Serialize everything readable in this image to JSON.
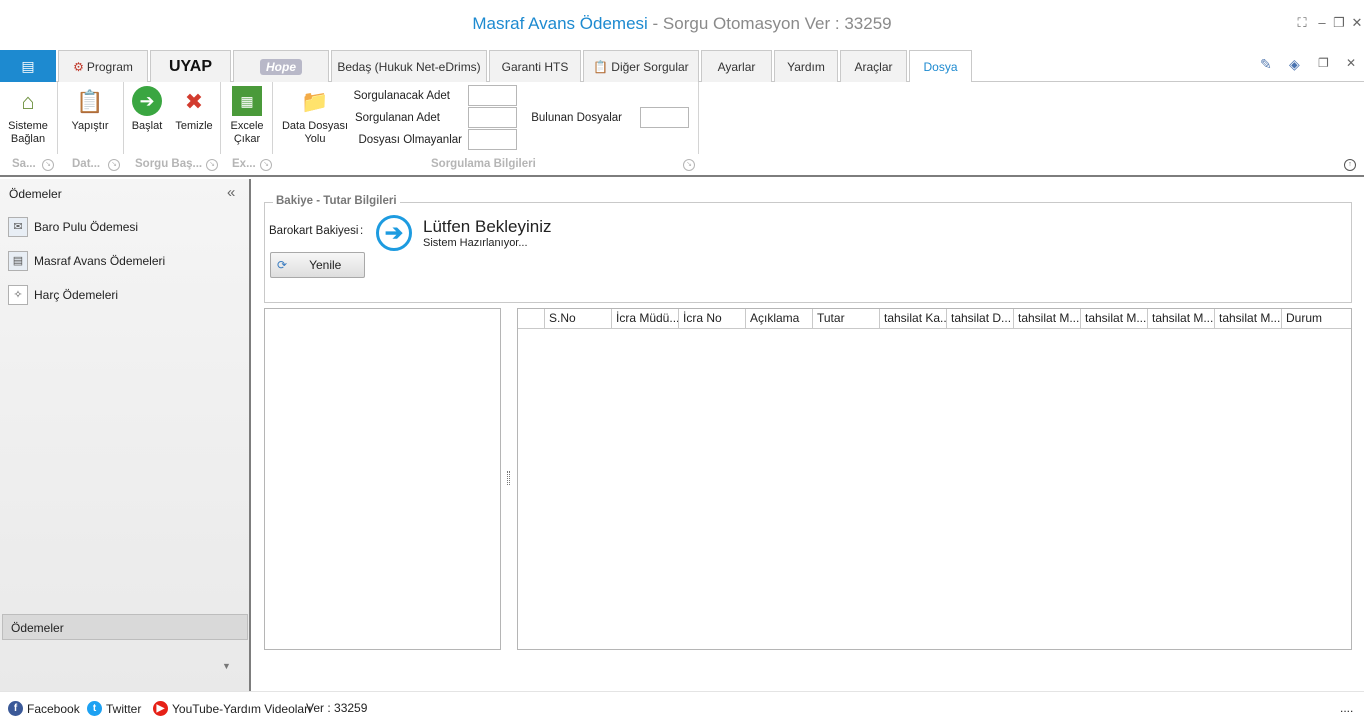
{
  "window": {
    "title_main": "Masraf Avans Ödemesi",
    "title_suffix": " - Sorgu Otomasyon Ver : 33259"
  },
  "tabs": {
    "app_menu": "▤",
    "program": "Program",
    "uyap": "UYAP",
    "hope": "Hope",
    "bedas": "Bedaş (Hukuk Net-eDrims)",
    "garanti": "Garanti HTS",
    "diger": "Diğer Sorgular",
    "ayarlar": "Ayarlar",
    "yardim": "Yardım",
    "araclar": "Araçlar",
    "dosya": "Dosya"
  },
  "ribbon": {
    "sisteme_baglan": "Sisteme Bağlan",
    "yapistir": "Yapıştır",
    "baslat": "Başlat",
    "temizle": "Temizle",
    "excele_cikar": "Excele Çıkar",
    "data_dosyasi_yolu": "Data Dosyası Yolu",
    "sorgulanacak_adet": "Sorgulanacak Adet",
    "sorgulanan_adet": "Sorgulanan Adet",
    "dosyasi_olmayanlar": "Dosyası Olmayanlar",
    "bulunan_dosyalar": "Bulunan Dosyalar"
  },
  "groups": {
    "g1": "Sa...",
    "g2": "Dat...",
    "g3": "Sorgu Baş...",
    "g4": "Ex...",
    "g5": "Sorgulama Bilgileri"
  },
  "sidebar": {
    "header": "Ödemeler",
    "collapse": "«",
    "items": [
      {
        "label": "Baro Pulu Ödemesi"
      },
      {
        "label": "Masraf Avans Ödemeleri"
      },
      {
        "label": "Harç Ödemeleri"
      }
    ],
    "footer_group": "Ödemeler"
  },
  "main": {
    "group_title": "Bakiye - Tutar Bilgileri",
    "barokart_label": "Barokart Bakiyesi",
    "colon": ":",
    "wait_title": "Lütfen Bekleyiniz",
    "wait_sub": "Sistem Hazırlanıyor...",
    "refresh": "Yenile"
  },
  "grid": {
    "columns": [
      "S.No",
      "İcra Müdü...",
      "İcra No",
      "Açıklama",
      "Tutar",
      "tahsilat Ka...",
      "tahsilat D...",
      "tahsilat M...",
      "tahsilat M...",
      "tahsilat M...",
      "tahsilat M...",
      "Durum"
    ]
  },
  "status": {
    "facebook": "Facebook",
    "twitter": "Twitter",
    "youtube": "YouTube-Yardım Videoları",
    "version": "Ver : 33259",
    "dots": "...."
  }
}
